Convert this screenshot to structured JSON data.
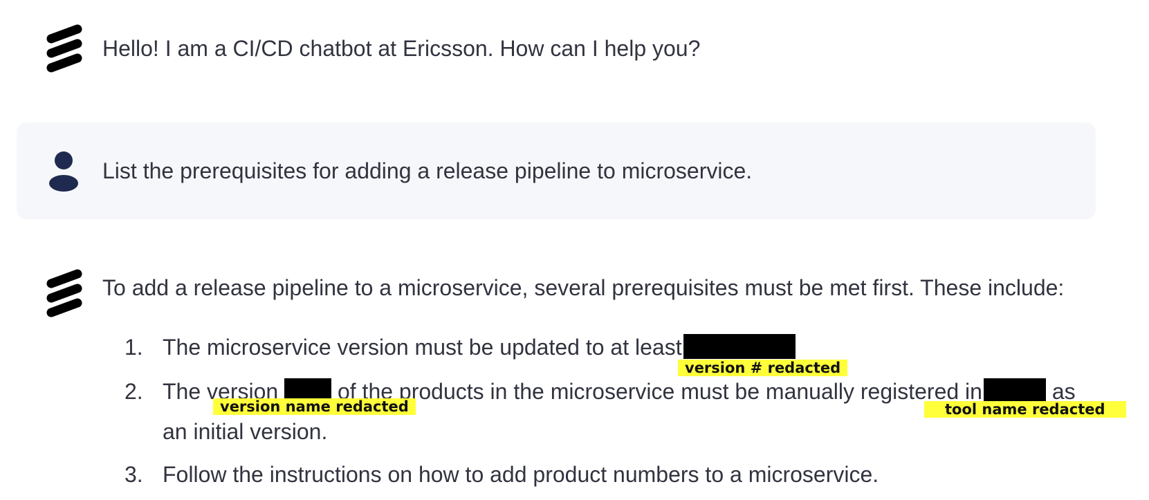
{
  "chat": {
    "greeting": {
      "avatar_icon": "ericsson-logo-icon",
      "text": "Hello! I am a CI/CD chatbot at Ericsson. How can I help you?"
    },
    "user_message": {
      "avatar_icon": "user-icon",
      "text": "List the prerequisites for adding a release pipeline to microservice."
    },
    "answer": {
      "avatar_icon": "ericsson-logo-icon",
      "intro": "To add a release pipeline to a microservice, several prerequisites must be met first. These include:",
      "items": [
        {
          "number": "1.",
          "text_before": "The microservice version must be updated to at least",
          "redaction_label": "version # redacted"
        },
        {
          "number": "2.",
          "text_before": "The version",
          "text_middle": "of the products in the microservice must be manually registered in",
          "text_after": "as",
          "text_line2": "an initial version.",
          "redaction_label_1": "version name redacted",
          "redaction_label_2": "tool name redacted"
        },
        {
          "number": "3.",
          "text": "Follow the instructions on how to add product numbers to a microservice."
        }
      ]
    }
  },
  "colors": {
    "text": "#31333f",
    "user_bubble_bg": "#f6f7fa",
    "user_icon": "#1e2a4f",
    "redaction": "#000000",
    "redaction_label_bg": "#ffff3a"
  }
}
